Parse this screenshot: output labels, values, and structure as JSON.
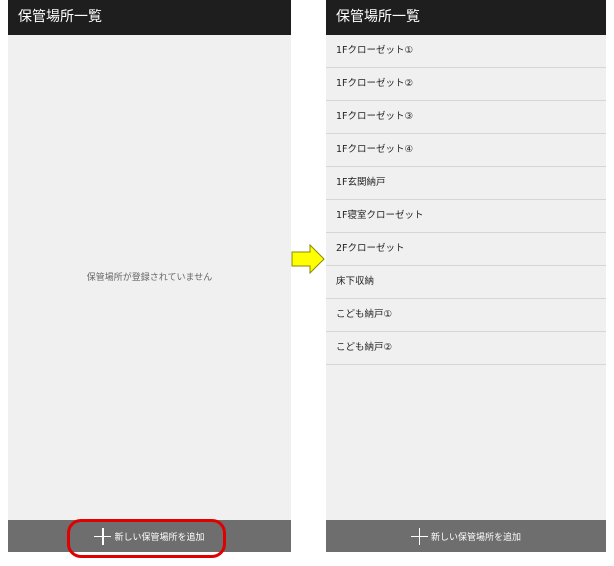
{
  "left_screen": {
    "title": "保管場所一覧",
    "empty_message": "保管場所が登録されていません",
    "add_button_label": "新しい保管場所を追加"
  },
  "right_screen": {
    "title": "保管場所一覧",
    "items": [
      "1Fクローゼット①",
      "1Fクローゼット②",
      "1Fクローゼット③",
      "1Fクローゼット④",
      "1F玄関納戸",
      "1F寝室クローゼット",
      "2Fクローゼット",
      "床下収納",
      "こども納戸①",
      "こども納戸②"
    ],
    "add_button_label": "新しい保管場所を追加"
  },
  "colors": {
    "titlebar": "#1e1e1e",
    "bottombar": "#6e6e6e",
    "highlight_ring": "#e00000",
    "arrow_fill": "#ffff00"
  },
  "icons": {
    "add": "plus-icon",
    "pointer": "arrow-right-icon"
  }
}
